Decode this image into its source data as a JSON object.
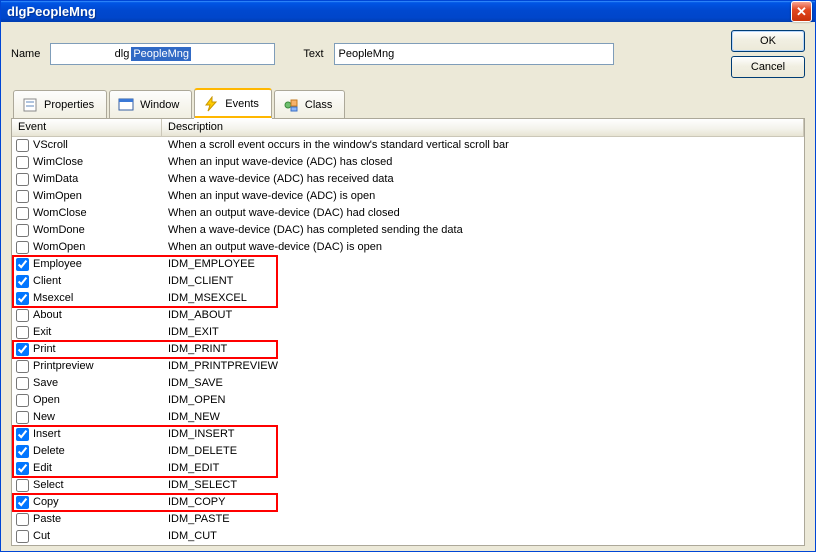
{
  "window": {
    "title": "dlgPeopleMng"
  },
  "fields": {
    "name_label": "Name",
    "name_prefix": "dlg",
    "name_value": "PeopleMng",
    "text_label": "Text",
    "text_value": "PeopleMng"
  },
  "buttons": {
    "ok": "OK",
    "cancel": "Cancel"
  },
  "tabs": [
    {
      "id": "properties",
      "label": "Properties",
      "active": false
    },
    {
      "id": "window",
      "label": "Window",
      "active": false
    },
    {
      "id": "events",
      "label": "Events",
      "active": true
    },
    {
      "id": "class",
      "label": "Class",
      "active": false
    }
  ],
  "columns": {
    "event": "Event",
    "description": "Description"
  },
  "rows": [
    {
      "event": "VScroll",
      "desc": "When a scroll event occurs in the window's standard vertical scroll bar",
      "checked": false
    },
    {
      "event": "WimClose",
      "desc": "When an input wave-device (ADC) has closed",
      "checked": false
    },
    {
      "event": "WimData",
      "desc": "When a wave-device (ADC) has received data",
      "checked": false
    },
    {
      "event": "WimOpen",
      "desc": "When an input wave-device (ADC) is open",
      "checked": false
    },
    {
      "event": "WomClose",
      "desc": "When an output wave-device (DAC) had closed",
      "checked": false
    },
    {
      "event": "WomDone",
      "desc": "When a wave-device (DAC) has completed sending the data",
      "checked": false
    },
    {
      "event": "WomOpen",
      "desc": "When an output wave-device (DAC) is open",
      "checked": false
    },
    {
      "event": "Employee",
      "desc": "IDM_EMPLOYEE",
      "checked": true
    },
    {
      "event": "Client",
      "desc": "IDM_CLIENT",
      "checked": true
    },
    {
      "event": "Msexcel",
      "desc": "IDM_MSEXCEL",
      "checked": true
    },
    {
      "event": "About",
      "desc": "IDM_ABOUT",
      "checked": false
    },
    {
      "event": "Exit",
      "desc": "IDM_EXIT",
      "checked": false
    },
    {
      "event": "Print",
      "desc": "IDM_PRINT",
      "checked": true
    },
    {
      "event": "Printpreview",
      "desc": "IDM_PRINTPREVIEW",
      "checked": false
    },
    {
      "event": "Save",
      "desc": "IDM_SAVE",
      "checked": false
    },
    {
      "event": "Open",
      "desc": "IDM_OPEN",
      "checked": false
    },
    {
      "event": "New",
      "desc": "IDM_NEW",
      "checked": false
    },
    {
      "event": "Insert",
      "desc": "IDM_INSERT",
      "checked": true
    },
    {
      "event": "Delete",
      "desc": "IDM_DELETE",
      "checked": true
    },
    {
      "event": "Edit",
      "desc": "IDM_EDIT",
      "checked": true
    },
    {
      "event": "Select",
      "desc": "IDM_SELECT",
      "checked": false
    },
    {
      "event": "Copy",
      "desc": "IDM_COPY",
      "checked": true
    },
    {
      "event": "Paste",
      "desc": "IDM_PASTE",
      "checked": false
    },
    {
      "event": "Cut",
      "desc": "IDM_CUT",
      "checked": false
    }
  ],
  "highlights": [
    {
      "from": "Employee",
      "to": "Msexcel"
    },
    {
      "from": "Print",
      "to": "Print"
    },
    {
      "from": "Insert",
      "to": "Edit"
    },
    {
      "from": "Copy",
      "to": "Copy"
    }
  ]
}
